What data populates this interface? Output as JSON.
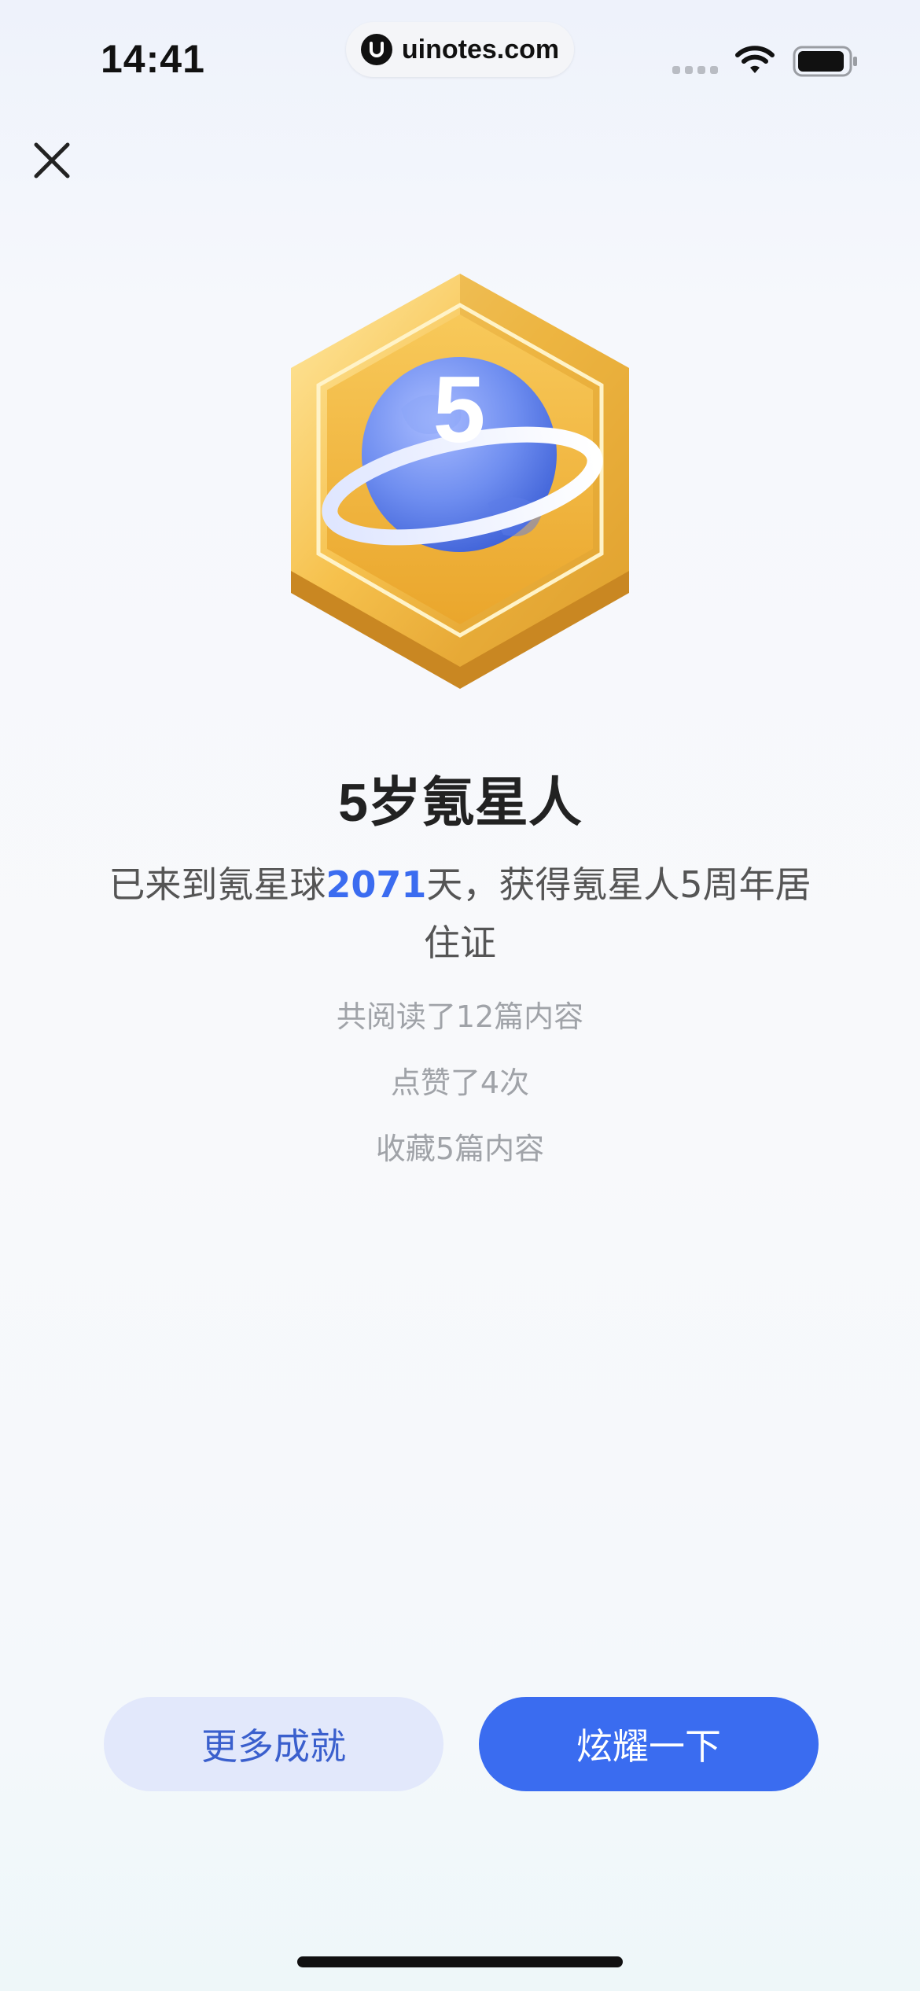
{
  "status_bar": {
    "time": "14:41",
    "url": "uinotes.com",
    "icons": [
      "signal-icon",
      "wifi-icon",
      "battery-icon"
    ]
  },
  "nav": {
    "close_icon": "close-icon"
  },
  "badge": {
    "number": "5",
    "icon": "planet-medal-icon"
  },
  "achievement": {
    "title": "5岁氪星人",
    "desc_prefix": "已来到氪星球",
    "days": "2071",
    "desc_suffix": "天，获得氪星人5周年居住证",
    "stats": [
      "共阅读了12篇内容",
      "点赞了4次",
      "收藏5篇内容"
    ]
  },
  "actions": {
    "more_label": "更多成就",
    "share_label": "炫耀一下"
  },
  "colors": {
    "accent": "#3a6cf0",
    "accent_light": "#e2e8fb",
    "gold": "#f2b83f",
    "planet": "#6f8ef0"
  }
}
